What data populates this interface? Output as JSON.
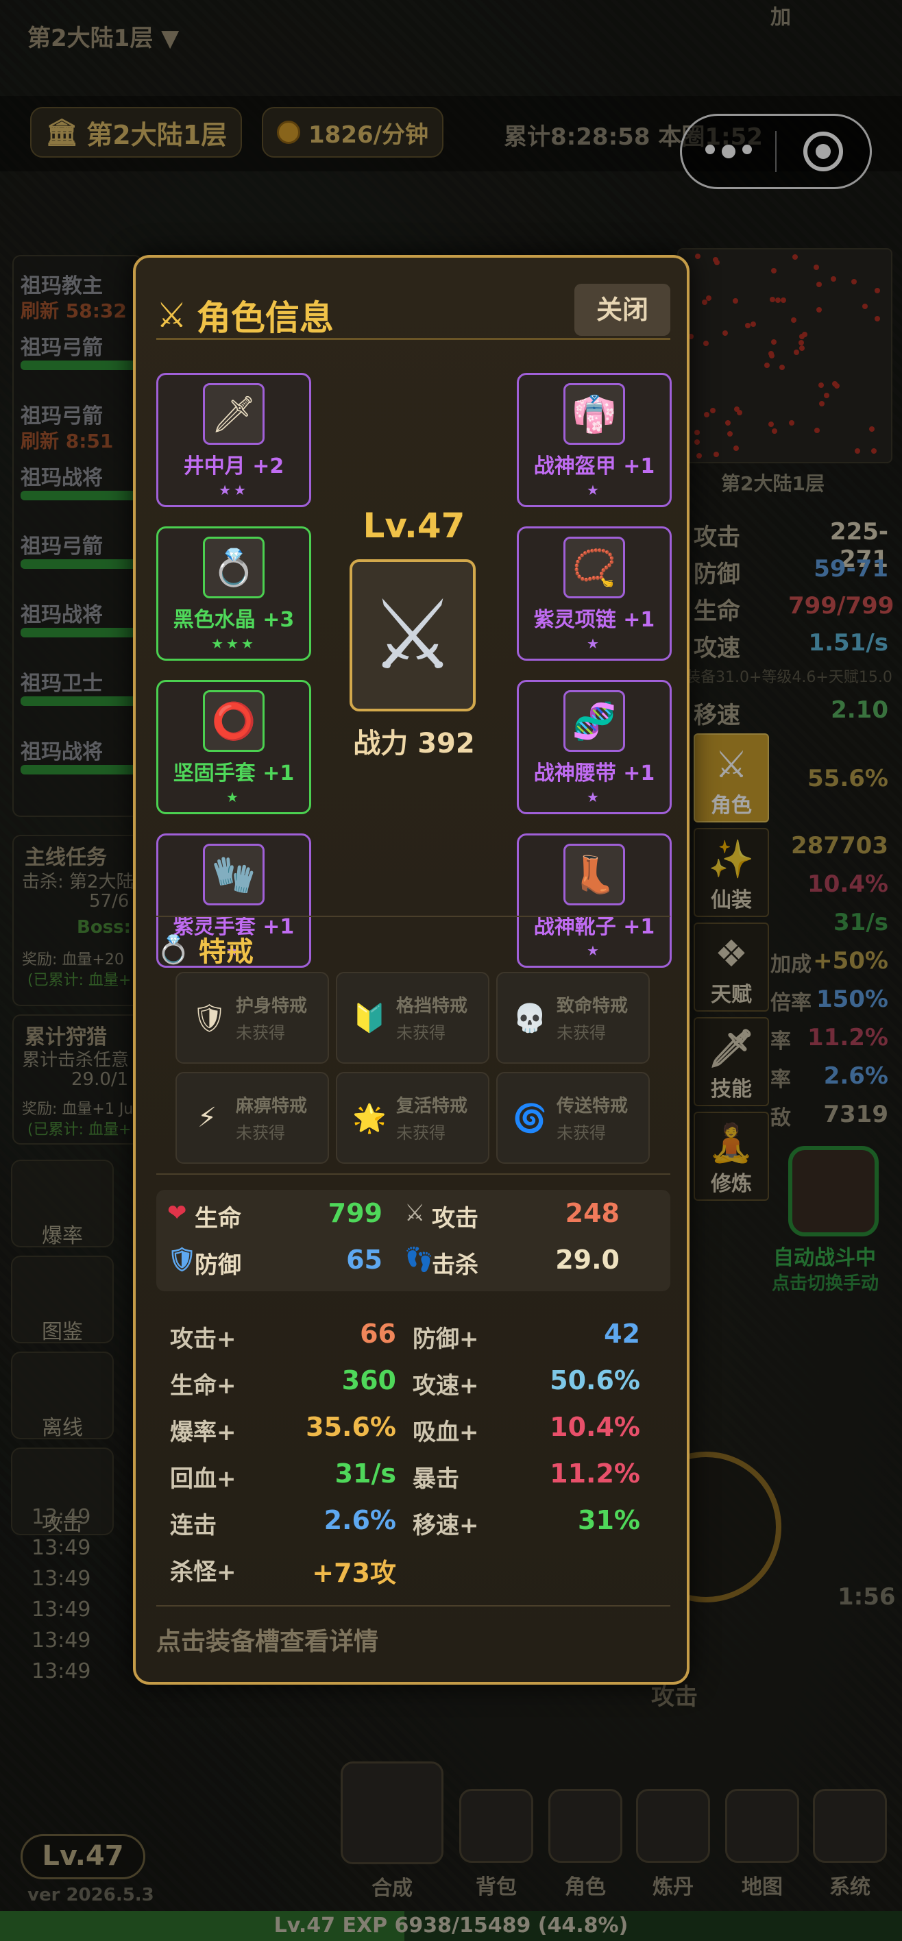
{
  "background": {
    "top_floor": "第2大陆1层 ▼",
    "floor_pill": "第2大陆1层",
    "gold_rate": "1826/分钟",
    "elapsed": "累计8:28:58 本圈1:52",
    "left_list": [
      {
        "label": "祖玛教主",
        "sub": "刷新 58:32"
      },
      {
        "label": "祖玛弓箭"
      },
      {
        "label": "祖玛弓箭",
        "sub": "刷新 8:51"
      },
      {
        "label": "祖玛战将"
      },
      {
        "label": "祖玛弓箭"
      },
      {
        "label": "祖玛战将"
      },
      {
        "label": "祖玛卫士"
      },
      {
        "label": "祖玛战将"
      }
    ],
    "quest": {
      "title": "主线任务",
      "line1": "击杀: 第2大陆",
      "progress": "57/6",
      "boss": "Boss:",
      "reward": "奖励: 血量+20",
      "claimed": "(已累计: 血量+"
    },
    "hunt": {
      "title": "累计狩猎",
      "line1": "累计击杀任意",
      "progress": "29.0/1",
      "reward": "奖励: 血量+1 Ju",
      "claimed": "(已累计: 血量+"
    },
    "side_buttons": [
      "爆率",
      "图鉴",
      "离线",
      "攻击"
    ],
    "log_times": [
      "13:49",
      "13:49",
      "13:49",
      "13:49",
      "13:49",
      "13:49"
    ],
    "map_label": "第2大陆1层",
    "right_stats": [
      {
        "label": "攻击",
        "value": "225-271",
        "color": "#d9cfb7"
      },
      {
        "label": "防御",
        "value": "59-71",
        "color": "#5f9bdc"
      },
      {
        "label": "生命",
        "value": "799/799",
        "color": "#c84f4f"
      },
      {
        "label": "攻速",
        "value": "1.51/s",
        "color": "#5fb6d8"
      },
      {
        "label": "移速",
        "value": "2.10",
        "color": "#58b060"
      }
    ],
    "speed_detail": "装备31.0+等级4.6+天赋15.0",
    "right_values": [
      "55.6%",
      "287703",
      "10.4%",
      "31/s",
      "+50%",
      "150%",
      "11.2%",
      "2.6%",
      "7319"
    ],
    "right_partial_labels": [
      "加成",
      "倍率",
      "率",
      "率",
      "敌",
      "加"
    ],
    "side_tabs": [
      {
        "icon": "⚔",
        "label": "角色",
        "active": true
      },
      {
        "icon": "✨",
        "label": "仙装",
        "active": false
      },
      {
        "icon": "❖",
        "label": "天赋",
        "active": false
      },
      {
        "icon": "🗡",
        "label": "技能",
        "active": false
      },
      {
        "icon": "🧘",
        "label": "修炼",
        "active": false
      }
    ],
    "auto_battle": "自动战斗中",
    "auto_switch": "点击切换手动",
    "attack_label": "攻击",
    "right_timer": "1:56",
    "bottom_nav": [
      "合成",
      "背包",
      "角色",
      "炼丹",
      "地图",
      "系统"
    ],
    "level_badge": "Lv.47",
    "version": "ver 2026.5.3",
    "exp_text": "Lv.47  EXP 6938/15489 (44.8%)",
    "exp_fraction": 0.448
  },
  "modal": {
    "title": "角色信息",
    "close_label": "关闭",
    "left_slots": [
      {
        "name": "井中月 +2",
        "stars": "★★",
        "icon": "🗡",
        "tier": "purple"
      },
      {
        "name": "黑色水晶 +3",
        "stars": "★★★",
        "icon": "💍",
        "tier": "green"
      },
      {
        "name": "坚固手套 +1",
        "stars": "★",
        "icon": "⭕",
        "tier": "green"
      },
      {
        "name": "紫灵手套 +1",
        "stars": "★",
        "icon": "🧤",
        "tier": "purple"
      }
    ],
    "right_slots": [
      {
        "name": "战神盔甲 +1",
        "stars": "★",
        "icon": "👘",
        "tier": "purple"
      },
      {
        "name": "紫灵项链 +1",
        "stars": "★",
        "icon": "📿",
        "tier": "purple"
      },
      {
        "name": "战神腰带 +1",
        "stars": "★",
        "icon": "🧬",
        "tier": "purple"
      },
      {
        "name": "战神靴子 +1",
        "stars": "★",
        "icon": "👢",
        "tier": "purple"
      }
    ],
    "char_level": "Lv.47",
    "char_icon": "⚔",
    "power": "战力 392",
    "rings_title": "特戒",
    "rings": [
      {
        "name": "护身特戒",
        "status": "未获得",
        "icon": "🛡"
      },
      {
        "name": "格挡特戒",
        "status": "未获得",
        "icon": "🔰"
      },
      {
        "name": "致命特戒",
        "status": "未获得",
        "icon": "💀"
      },
      {
        "name": "麻痹特戒",
        "status": "未获得",
        "icon": "⚡"
      },
      {
        "name": "复活特戒",
        "status": "未获得",
        "icon": "🌟"
      },
      {
        "name": "传送特戒",
        "status": "未获得",
        "icon": "🌀"
      }
    ],
    "summary": [
      {
        "icon": "❤",
        "label": "生命",
        "value": "799",
        "color": "#4fd85a"
      },
      {
        "icon": "⚔",
        "label": "攻击",
        "value": "248",
        "color": "#f07a5a"
      },
      {
        "icon": "🛡",
        "label": "防御",
        "value": "65",
        "color": "#5ea8f0"
      },
      {
        "icon": "👣",
        "label": "击杀",
        "value": "29.0",
        "color": "#efe2c0"
      }
    ],
    "stats": [
      {
        "label": "攻击+",
        "value": "66",
        "color": "#f0865a"
      },
      {
        "label": "防御+",
        "value": "42",
        "color": "#5ea8f0"
      },
      {
        "label": "生命+",
        "value": "360",
        "color": "#4fd85a"
      },
      {
        "label": "攻速+",
        "value": "50.6%",
        "color": "#7ec8e8"
      },
      {
        "label": "爆率+",
        "value": "35.6%",
        "color": "#f0b94a"
      },
      {
        "label": "吸血+",
        "value": "10.4%",
        "color": "#e8506a"
      },
      {
        "label": "回血+",
        "value": "31/s",
        "color": "#4fd85a"
      },
      {
        "label": "暴击",
        "value": "11.2%",
        "color": "#e8506a"
      },
      {
        "label": "连击",
        "value": "2.6%",
        "color": "#5ea8f0"
      },
      {
        "label": "移速+",
        "value": "31%",
        "color": "#4fd85a"
      },
      {
        "label": "杀怪+",
        "value": "+73攻",
        "color": "#f0b94a"
      }
    ],
    "hint": "点击装备槽查看详情"
  }
}
